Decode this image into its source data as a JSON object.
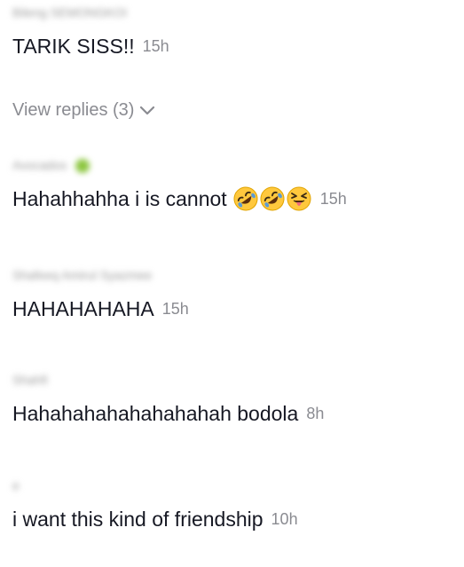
{
  "comments": [
    {
      "username": "Bileng SEMONGKOI",
      "text": "TARIK SISS!!",
      "time": "15h",
      "view_replies": "View replies (3)"
    },
    {
      "username": "Avocados",
      "text": "Hahahhahha i is cannot",
      "time": "15h",
      "emojis": [
        "rolling-on-floor-laughing",
        "rolling-on-floor-laughing",
        "squinting-face-with-tongue"
      ]
    },
    {
      "username": "Shafeeq Amirul Syazmee",
      "text": "HAHAHAHAHA",
      "time": "15h"
    },
    {
      "username": "Shahfi",
      "text": "Hahahahahahahahahah bodola",
      "time": "8h"
    },
    {
      "username": "e",
      "text": "i want this kind of friendship",
      "time": "10h"
    }
  ],
  "colors": {
    "text": "#161823",
    "muted": "#8a8b91",
    "emoji_yellow": "#ffc83d",
    "emoji_blue": "#5b9bd5"
  }
}
